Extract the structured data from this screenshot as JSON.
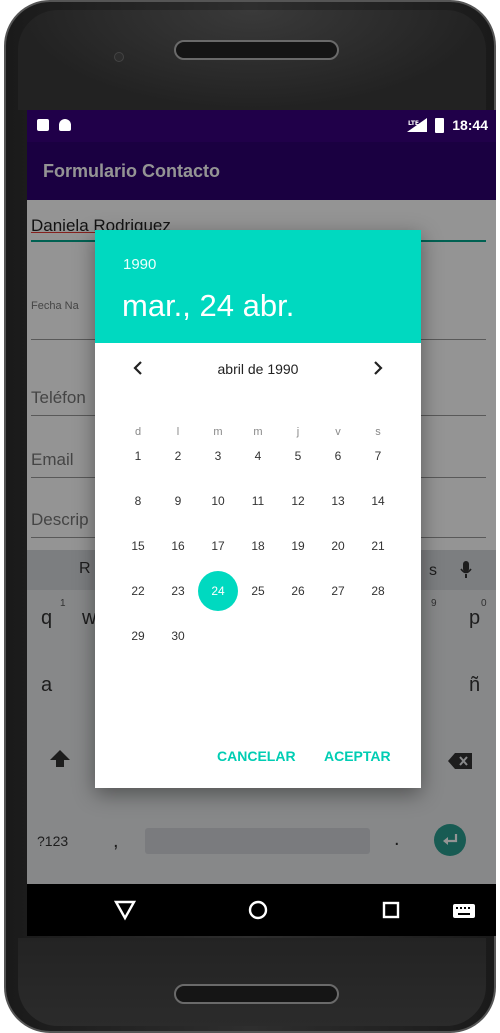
{
  "status_bar": {
    "time": "18:44"
  },
  "app_bar": {
    "title": "Formulario Contacto"
  },
  "form": {
    "name_value": "Daniela Rodriguez",
    "fecha_label": "Fecha Na",
    "telefono_placeholder": "Teléfon",
    "email_placeholder": "Email",
    "descripcion_placeholder": "Descrip"
  },
  "keyboard": {
    "visible_keys": [
      "R",
      "s",
      "q",
      "w",
      "p",
      "a",
      "ñ",
      "?123",
      ",",
      "."
    ],
    "superscripts": [
      "1",
      "9",
      "0"
    ]
  },
  "date_picker": {
    "year": "1990",
    "selected_date_label": "mar., 24 abr.",
    "month_label": "abril de 1990",
    "weekday_headers": [
      "d",
      "l",
      "m",
      "m",
      "j",
      "v",
      "s"
    ],
    "weeks": [
      [
        "1",
        "2",
        "3",
        "4",
        "5",
        "6",
        "7"
      ],
      [
        "8",
        "9",
        "10",
        "11",
        "12",
        "13",
        "14"
      ],
      [
        "15",
        "16",
        "17",
        "18",
        "19",
        "20",
        "21"
      ],
      [
        "22",
        "23",
        "24",
        "25",
        "26",
        "27",
        "28"
      ],
      [
        "29",
        "30"
      ]
    ],
    "selected_day": "24",
    "cancel_label": "CANCELAR",
    "accept_label": "ACEPTAR",
    "accent_color": "#00D9C0"
  },
  "colors": {
    "status_bar": "#200049",
    "app_bar": "#2E0070",
    "field_accent": "#00A88E"
  },
  "icons": [
    "chevron-left-icon",
    "chevron-right-icon",
    "back-triangle-icon",
    "home-circle-icon",
    "recents-square-icon",
    "keyboard-icon",
    "mic-icon",
    "shift-icon",
    "backspace-icon",
    "enter-icon",
    "signal-icon",
    "battery-icon"
  ]
}
